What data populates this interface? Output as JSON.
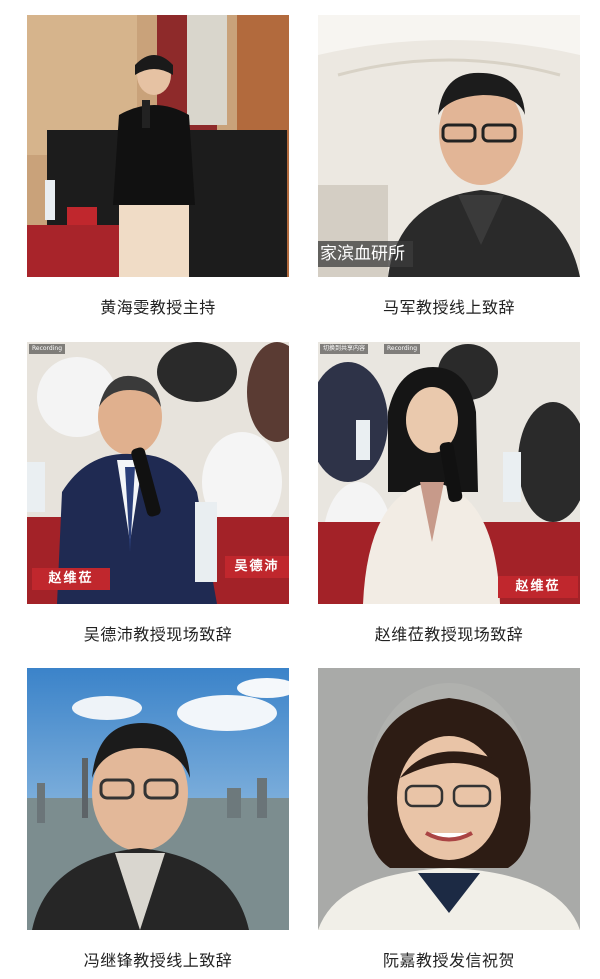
{
  "photos": [
    {
      "caption": "黄海雯教授主持"
    },
    {
      "caption": "马军教授线上致辞",
      "overlay": "家滨血研所"
    },
    {
      "caption": "吴德沛教授现场致辞",
      "nameplates": [
        "赵维莅",
        "吴德沛"
      ],
      "rec": "Recording"
    },
    {
      "caption": "赵维莅教授现场致辞",
      "nameplates": [
        "赵维莅"
      ],
      "rec": "Recording",
      "rec2": "切换到共享内容"
    },
    {
      "caption": "冯继锋教授线上致辞"
    },
    {
      "caption": "阮嘉教授发信祝贺"
    }
  ]
}
